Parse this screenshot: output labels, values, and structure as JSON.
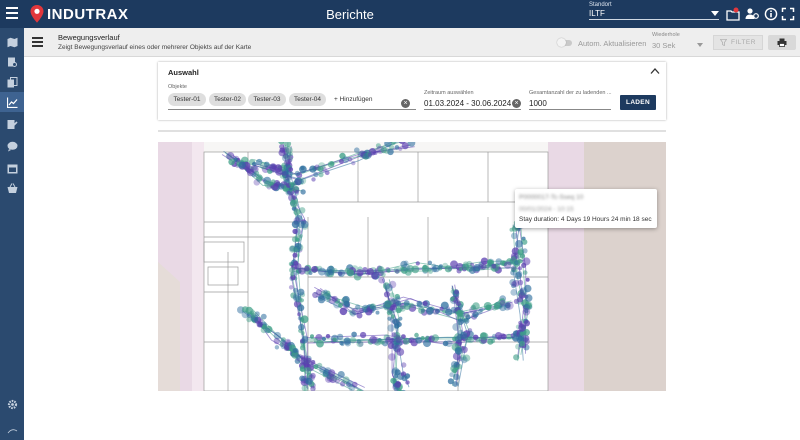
{
  "app": {
    "logo_text": "INDUTRAX",
    "title": "Berichte",
    "standort_label": "Standort",
    "standort_value": "ILTF"
  },
  "header": {
    "title": "Bewegungsverlauf",
    "description": "Zeigt Bewegungsverlauf eines oder mehrerer Objekts auf der Karte",
    "auto_refresh_label": "Autom. Aktualisieren",
    "wiederholen_label": "Wiederhole",
    "wiederholen_value": "30 Sek",
    "filter_label": "FILTER"
  },
  "selection": {
    "title": "Auswahl",
    "objects_label": "Objekte",
    "objects": [
      "Tester-01",
      "Tester-02",
      "Tester-03",
      "Tester-04"
    ],
    "add_label": "+ Hinzufügen",
    "period_label": "Zeitraum auswählen",
    "period_value": "01.03.2024 - 30.06.2024",
    "count_label": "Gesamtanzahl der zu ladenden ...",
    "count_value": "1000",
    "load_label": "LADEN"
  },
  "tooltip": {
    "line1": "P0000017-Tc-Sseq 10",
    "line2": "00/01/2024 - 10:15",
    "stay": "Stay duration: 4 Days 19 Hours 24 min 18 sec"
  },
  "colors": {
    "topbar": "#1d3a5f",
    "sidebar": "#2b4a6f",
    "track_green": "#3f9f87",
    "track_purple": "#5b3fb0",
    "track_blue": "#2f6f9f"
  },
  "icons": {
    "sidebar": [
      "map-icon",
      "document-search-icon",
      "copy-icon",
      "chart-icon",
      "edit-list-icon",
      "chat-icon",
      "calendar-icon",
      "basket-icon"
    ],
    "top": [
      "map-pin-icon",
      "user-settings-icon",
      "info-icon",
      "fullscreen-icon"
    ]
  }
}
